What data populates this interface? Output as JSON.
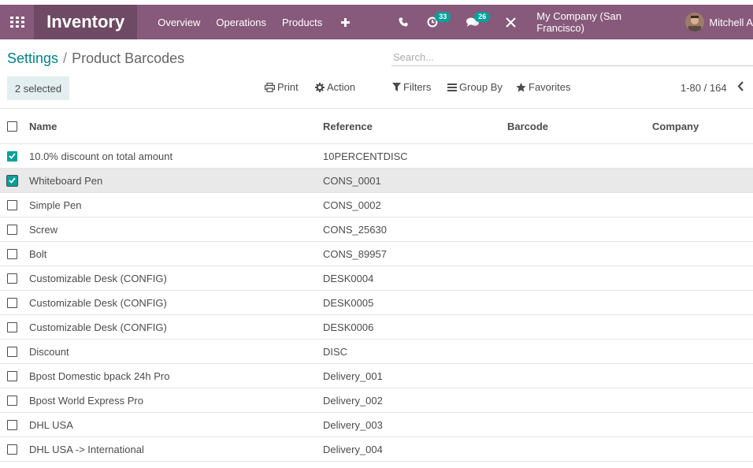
{
  "navbar": {
    "brand": "Inventory",
    "menu": [
      "Overview",
      "Operations",
      "Products"
    ],
    "activity_count": "33",
    "messages_count": "26",
    "company": "My Company (San Francisco)",
    "user": "Mitchell A"
  },
  "breadcrumb": {
    "parent": "Settings",
    "current": "Product Barcodes"
  },
  "search": {
    "placeholder": "Search..."
  },
  "toolbar": {
    "selected": "2 selected",
    "print": "Print",
    "action": "Action",
    "filters": "Filters",
    "group_by": "Group By",
    "favorites": "Favorites",
    "pager": "1-80 / 164"
  },
  "table": {
    "headers": {
      "name": "Name",
      "reference": "Reference",
      "barcode": "Barcode",
      "company": "Company"
    },
    "rows": [
      {
        "name": "10.0% discount on total amount",
        "ref": "10PERCENTDISC",
        "barcode": "",
        "company": "",
        "checked": true
      },
      {
        "name": "Whiteboard Pen",
        "ref": "CONS_0001",
        "barcode": "",
        "company": "",
        "checked": true
      },
      {
        "name": "Simple Pen",
        "ref": "CONS_0002",
        "barcode": "",
        "company": "",
        "checked": false
      },
      {
        "name": "Screw",
        "ref": "CONS_25630",
        "barcode": "",
        "company": "",
        "checked": false
      },
      {
        "name": "Bolt",
        "ref": "CONS_89957",
        "barcode": "",
        "company": "",
        "checked": false
      },
      {
        "name": "Customizable Desk (CONFIG)",
        "ref": "DESK0004",
        "barcode": "",
        "company": "",
        "checked": false
      },
      {
        "name": "Customizable Desk (CONFIG)",
        "ref": "DESK0005",
        "barcode": "",
        "company": "",
        "checked": false
      },
      {
        "name": "Customizable Desk (CONFIG)",
        "ref": "DESK0006",
        "barcode": "",
        "company": "",
        "checked": false
      },
      {
        "name": "Discount",
        "ref": "DISC",
        "barcode": "",
        "company": "",
        "checked": false
      },
      {
        "name": "Bpost Domestic bpack 24h Pro",
        "ref": "Delivery_001",
        "barcode": "",
        "company": "",
        "checked": false
      },
      {
        "name": "Bpost World Express Pro",
        "ref": "Delivery_002",
        "barcode": "",
        "company": "",
        "checked": false
      },
      {
        "name": "DHL USA",
        "ref": "Delivery_003",
        "barcode": "",
        "company": "",
        "checked": false
      },
      {
        "name": "DHL USA -> International",
        "ref": "Delivery_004",
        "barcode": "",
        "company": "",
        "checked": false
      }
    ]
  },
  "colors": {
    "navbar": "#875a7b",
    "brand_bg": "#6e4a65",
    "accent": "#00a09d",
    "link": "#00838a"
  }
}
